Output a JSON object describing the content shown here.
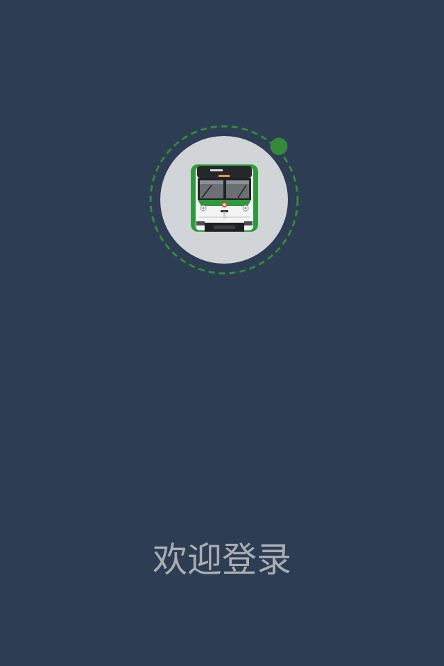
{
  "screen": {
    "welcome_text": "欢迎登录",
    "logo_icon": "metro-train-icon"
  },
  "colors": {
    "background": "#2d3d53",
    "welcome_text": "#a9adb2",
    "orbit_ring": "#35893a",
    "orbit_dot": "#35893a",
    "logo_disc": "#d1d5d8",
    "train_green": "#2f9a3c",
    "train_body": "#f3f4f3",
    "train_dark": "#25272a",
    "train_window": "#6c6f74"
  }
}
